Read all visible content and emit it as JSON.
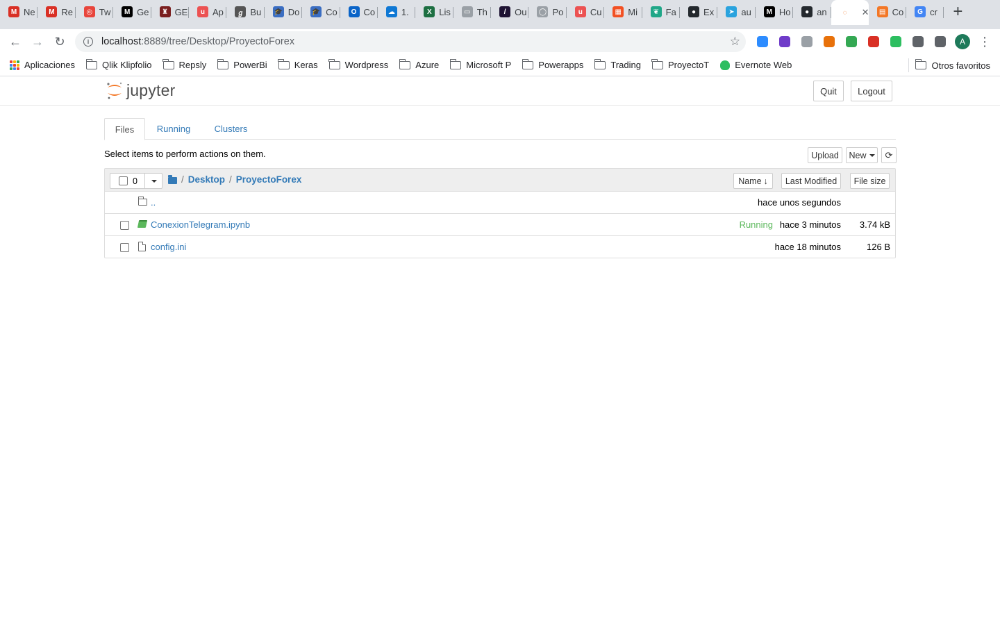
{
  "browser": {
    "tabs": [
      {
        "label": "Ne",
        "icon": "gmail-icon",
        "color": "#d93025",
        "glyph": "M"
      },
      {
        "label": "Re",
        "icon": "gmail-icon",
        "color": "#d93025",
        "glyph": "M"
      },
      {
        "label": "Tw",
        "icon": "lifebuoy-icon",
        "color": "#e8453c",
        "glyph": "◎"
      },
      {
        "label": "Ge",
        "icon": "medium-icon",
        "color": "#000000",
        "glyph": "M"
      },
      {
        "label": "GE",
        "icon": "shield-icon",
        "color": "#7a1f1f",
        "glyph": "♜"
      },
      {
        "label": "Ap",
        "icon": "udemy-icon",
        "color": "#ec5252",
        "glyph": "u"
      },
      {
        "label": "Bu",
        "icon": "tool-icon",
        "color": "#555555",
        "glyph": "ℊ"
      },
      {
        "label": "Do",
        "icon": "graduation-cap-icon",
        "color": "#3b6ec2",
        "glyph": "🎓"
      },
      {
        "label": "Co",
        "icon": "graduation-cap-icon",
        "color": "#3b6ec2",
        "glyph": "🎓"
      },
      {
        "label": "Co",
        "icon": "outlook-icon",
        "color": "#0a64c8",
        "glyph": "O"
      },
      {
        "label": "1.",
        "icon": "onedrive-icon",
        "color": "#0f78d4",
        "glyph": "☁"
      },
      {
        "label": "Lis",
        "icon": "excel-icon",
        "color": "#1d6f42",
        "glyph": "X"
      },
      {
        "label": "Th",
        "icon": "page-icon",
        "color": "#9aa0a6",
        "glyph": "▭"
      },
      {
        "label": "Ou",
        "icon": "notion-icon",
        "color": "#1e1333",
        "glyph": "/"
      },
      {
        "label": "Po",
        "icon": "bubble-icon",
        "color": "#9aa0a6",
        "glyph": "◯"
      },
      {
        "label": "Cu",
        "icon": "udemy-icon",
        "color": "#ec5252",
        "glyph": "u"
      },
      {
        "label": "Mi",
        "icon": "microsoft-icon",
        "color": "#f25022",
        "glyph": "▦"
      },
      {
        "label": "Fa",
        "icon": "leaf-icon",
        "color": "#20a788",
        "glyph": "❦"
      },
      {
        "label": "Ex",
        "icon": "github-icon",
        "color": "#24292e",
        "glyph": "●"
      },
      {
        "label": "au",
        "icon": "telegram-icon",
        "color": "#2aa3de",
        "glyph": "➤"
      },
      {
        "label": "Ho",
        "icon": "medium-icon",
        "color": "#000000",
        "glyph": "M"
      },
      {
        "label": "an",
        "icon": "github-icon",
        "color": "#24292e",
        "glyph": "●"
      },
      {
        "label": "",
        "icon": "jupyter-icon",
        "color": "#f37726",
        "glyph": "◌",
        "active": true
      },
      {
        "label": "Co",
        "icon": "notebook-icon",
        "color": "#f37726",
        "glyph": "▤"
      },
      {
        "label": "cr",
        "icon": "google-icon",
        "color": "#4285f4",
        "glyph": "G"
      }
    ],
    "address": {
      "host": "localhost",
      "rest": ":8889/tree/Desktop/ProyectoForex"
    },
    "extensions": [
      {
        "name": "zoom-extension-icon",
        "color": "#2d8cff"
      },
      {
        "name": "color-picker-extension-icon",
        "color": "#6f3cc9"
      },
      {
        "name": "screenshot-extension-icon",
        "color": "#9aa0a6"
      },
      {
        "name": "flame-extension-icon",
        "color": "#e8710a"
      },
      {
        "name": "mail-check-extension-icon",
        "color": "#34a853"
      },
      {
        "name": "calendar-extension-icon",
        "color": "#d93025"
      },
      {
        "name": "evernote-extension-icon",
        "color": "#2dbe60"
      },
      {
        "name": "puzzle-extension-icon",
        "color": "#5f6368"
      },
      {
        "name": "media-control-icon",
        "color": "#5f6368"
      }
    ],
    "avatar_letter": "A",
    "bookmarks": [
      {
        "label": "Aplicaciones",
        "type": "apps"
      },
      {
        "label": "Qlik Klipfolio",
        "type": "folder"
      },
      {
        "label": "Repsly",
        "type": "folder"
      },
      {
        "label": "PowerBi",
        "type": "folder"
      },
      {
        "label": "Keras",
        "type": "folder"
      },
      {
        "label": "Wordpress",
        "type": "folder"
      },
      {
        "label": "Azure",
        "type": "folder"
      },
      {
        "label": "Microsoft P",
        "type": "folder"
      },
      {
        "label": "Powerapps",
        "type": "folder"
      },
      {
        "label": "Trading",
        "type": "folder"
      },
      {
        "label": "ProyectoT",
        "type": "folder"
      },
      {
        "label": "Evernote Web",
        "type": "evernote"
      }
    ],
    "other_bookmarks": "Otros favoritos"
  },
  "jupyter": {
    "logo_text": "jupyter",
    "quit_label": "Quit",
    "logout_label": "Logout",
    "tabs": [
      "Files",
      "Running",
      "Clusters"
    ],
    "select_message": "Select items to perform actions on them.",
    "upload_label": "Upload",
    "new_label": "New",
    "selected_count": "0",
    "breadcrumb": [
      "Desktop",
      "ProyectoForex"
    ],
    "sort_headers": {
      "name": "Name",
      "last_modified": "Last Modified",
      "file_size": "File size"
    },
    "files": [
      {
        "name": "..",
        "type": "folder",
        "status": "",
        "modified": "hace unos segundos",
        "size": ""
      },
      {
        "name": "ConexionTelegram.ipynb",
        "type": "notebook",
        "status": "Running",
        "modified": "hace 3 minutos",
        "size": "3.74 kB"
      },
      {
        "name": "config.ini",
        "type": "file",
        "status": "",
        "modified": "hace 18 minutos",
        "size": "126 B"
      }
    ],
    "colors": {
      "link": "#337ab7",
      "running": "#5cb85c",
      "brand": "#f37726"
    }
  }
}
